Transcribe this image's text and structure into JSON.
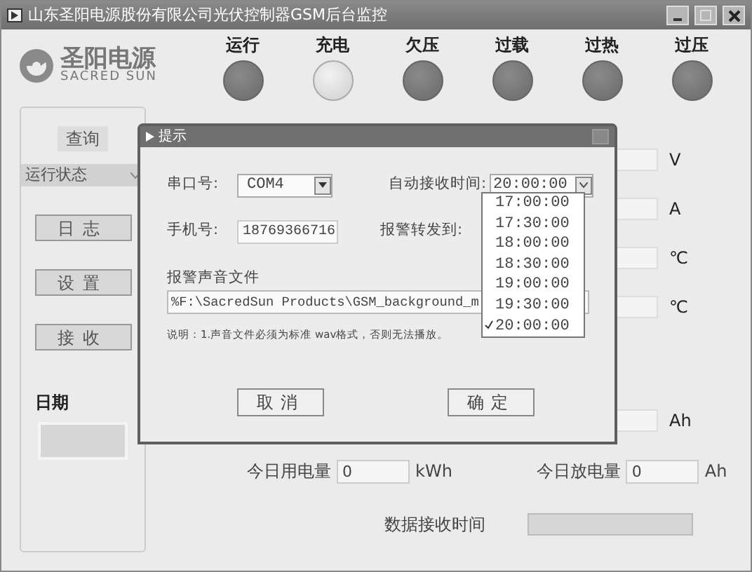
{
  "window": {
    "title": "山东圣阳电源股份有限公司光伏控制器GSM后台监控"
  },
  "logo": {
    "name": "圣阳电源",
    "subtitle": "SACRED SUN"
  },
  "indicators": [
    {
      "label": "运行",
      "on": false
    },
    {
      "label": "充电",
      "on": true
    },
    {
      "label": "欠压",
      "on": false
    },
    {
      "label": "过载",
      "on": false
    },
    {
      "label": "过热",
      "on": false
    },
    {
      "label": "过压",
      "on": false
    }
  ],
  "sidebar": {
    "query_label": "查询",
    "query_select": "运行状态",
    "buttons": [
      "日志",
      "设置",
      "接收"
    ],
    "date_label": "日期"
  },
  "readings": [
    {
      "unit": "V"
    },
    {
      "unit": "A"
    },
    {
      "unit": "℃"
    },
    {
      "unit": "℃"
    },
    {
      "unit": "Ah"
    }
  ],
  "totals": [
    {
      "label": "今日用电量",
      "value": "0",
      "unit": "kWh"
    },
    {
      "label": "今日放电量",
      "value": "0",
      "unit": "Ah"
    }
  ],
  "receive_time": {
    "label": "数据接收时间"
  },
  "dialog": {
    "title": "提示",
    "port_label": "串口号:",
    "port_value": "COM4",
    "auto_label": "自动接收时间:",
    "auto_value": "20:00:00",
    "phone_label": "手机号:",
    "phone_value": "18769366716",
    "forward_label": "报警转发到:",
    "sound_label": "报警声音文件",
    "sound_path": "%F:\\SacredSun Products\\GSM_background_m",
    "note": "说明：1.声音文件必须为标准 wav格式，否则无法播放。",
    "buttons": [
      "取消",
      "确定"
    ],
    "time_options": [
      {
        "label": "17:00:00",
        "selected": false
      },
      {
        "label": "17:30:00",
        "selected": false
      },
      {
        "label": "18:00:00",
        "selected": false
      },
      {
        "label": "18:30:00",
        "selected": false
      },
      {
        "label": "19:00:00",
        "selected": false
      },
      {
        "label": "19:30:00",
        "selected": false
      },
      {
        "label": "20:00:00",
        "selected": true
      }
    ]
  }
}
